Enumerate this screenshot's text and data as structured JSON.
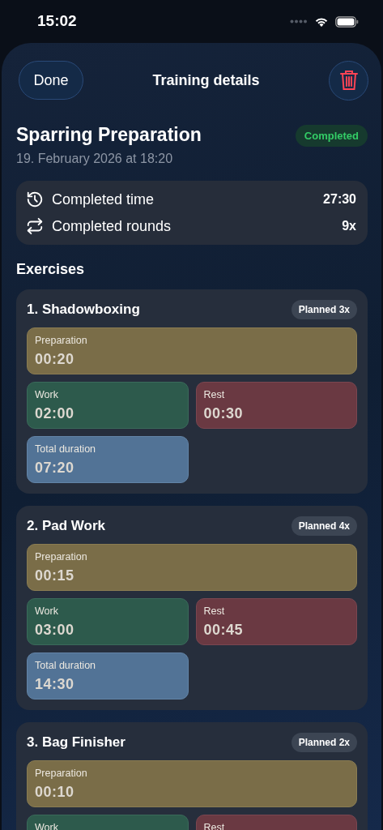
{
  "status_bar": {
    "time": "15:02"
  },
  "header": {
    "done_button": "Done",
    "title": "Training details"
  },
  "training": {
    "name": "Sparring Preparation",
    "status": "Completed",
    "date": "19. February 2026 at 18:20"
  },
  "summary": [
    {
      "kind": "time",
      "label": "Completed time",
      "value": "27:30"
    },
    {
      "kind": "rounds",
      "label": "Completed rounds",
      "value": "9x"
    }
  ],
  "exercises_heading": "Exercises",
  "exercises": [
    {
      "name": "1. Shadowboxing",
      "planned": "Planned 3x",
      "tiles": [
        {
          "kind": "preparation",
          "label": "Preparation",
          "value": "00:20"
        },
        {
          "kind": "work",
          "label": "Work",
          "value": "02:00"
        },
        {
          "kind": "rest",
          "label": "Rest",
          "value": "00:30"
        },
        {
          "kind": "total",
          "label": "Total duration",
          "value": "07:20"
        }
      ]
    },
    {
      "name": "2. Pad Work",
      "planned": "Planned 4x",
      "tiles": [
        {
          "kind": "preparation",
          "label": "Preparation",
          "value": "00:15"
        },
        {
          "kind": "work",
          "label": "Work",
          "value": "03:00"
        },
        {
          "kind": "rest",
          "label": "Rest",
          "value": "00:45"
        },
        {
          "kind": "total",
          "label": "Total duration",
          "value": "14:30"
        }
      ]
    },
    {
      "name": "3. Bag Finisher",
      "planned": "Planned 2x",
      "tiles": [
        {
          "kind": "preparation",
          "label": "Preparation",
          "value": "00:10"
        },
        {
          "kind": "work",
          "label": "Work"
        },
        {
          "kind": "rest",
          "label": "Rest"
        }
      ]
    }
  ]
}
